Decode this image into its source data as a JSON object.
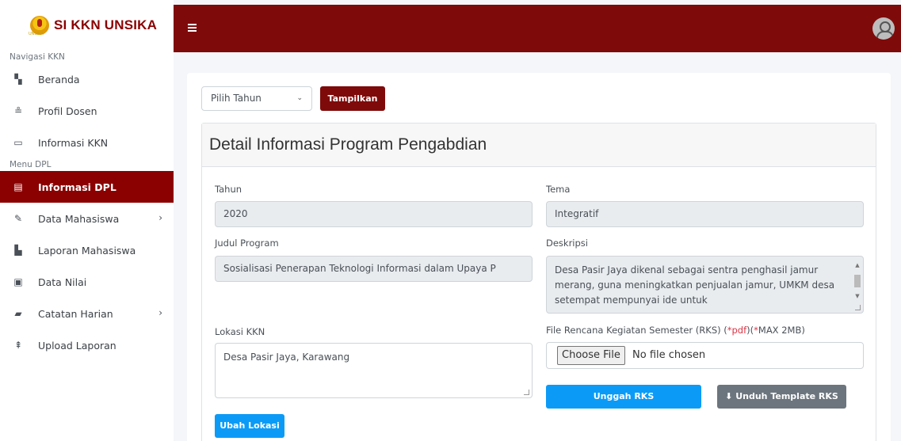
{
  "brand": {
    "title": "SI KKN UNSIKA",
    "logo_text": "UNSIKA"
  },
  "sidebar": {
    "header_nav": "Navigasi KKN",
    "header_menu": "Menu DPL",
    "items": [
      {
        "label": "Beranda",
        "icon": "dashboard-icon"
      },
      {
        "label": "Profil Dosen",
        "icon": "user-icon"
      },
      {
        "label": "Informasi KKN",
        "icon": "id-card-icon"
      },
      {
        "label": "Informasi DPL",
        "icon": "info-icon"
      },
      {
        "label": "Data Mahasiswa",
        "icon": "edit-icon"
      },
      {
        "label": "Laporan Mahasiswa",
        "icon": "file-icon"
      },
      {
        "label": "Data Nilai",
        "icon": "calendar-icon"
      },
      {
        "label": "Catatan Harian",
        "icon": "book-icon"
      },
      {
        "label": "Upload Laporan",
        "icon": "upload-icon"
      }
    ]
  },
  "colors": {
    "primary": "#7f0a0a",
    "blue": "#0b9bf7",
    "grey": "#6c757d"
  },
  "filter": {
    "select_value": "Pilih Tahun",
    "button": "Tampilkan"
  },
  "detail": {
    "title": "Detail Informasi Program Pengabdian",
    "tahun_label": "Tahun",
    "tahun_value": "2020",
    "tema_label": "Tema",
    "tema_value": "Integratif",
    "judul_label": "Judul Program",
    "judul_value": "Sosialisasi Penerapan Teknologi Informasi dalam Upaya P",
    "deskripsi_label": "Deskripsi",
    "deskripsi_value": "Desa Pasir Jaya dikenal sebagai sentra penghasil jamur merang, guna meningkatkan penjualan jamur, UMKM desa setempat mempunyai ide untuk",
    "lokasi_label": "Lokasi KKN",
    "lokasi_value": "Desa Pasir Jaya, Karawang",
    "rks_label": "File Rencana Kegiatan Semester (RKS) (",
    "rks_pdf": "*pdf",
    "rks_mid": ")(",
    "rks_max": "*",
    "rks_max_text": "MAX 2MB)",
    "choose_file": "Choose File",
    "no_file": "No file chosen",
    "upload_button": "Unggah RKS",
    "download_button": "⬇ Unduh Template RKS",
    "ubah_button": "Ubah Lokasi"
  }
}
